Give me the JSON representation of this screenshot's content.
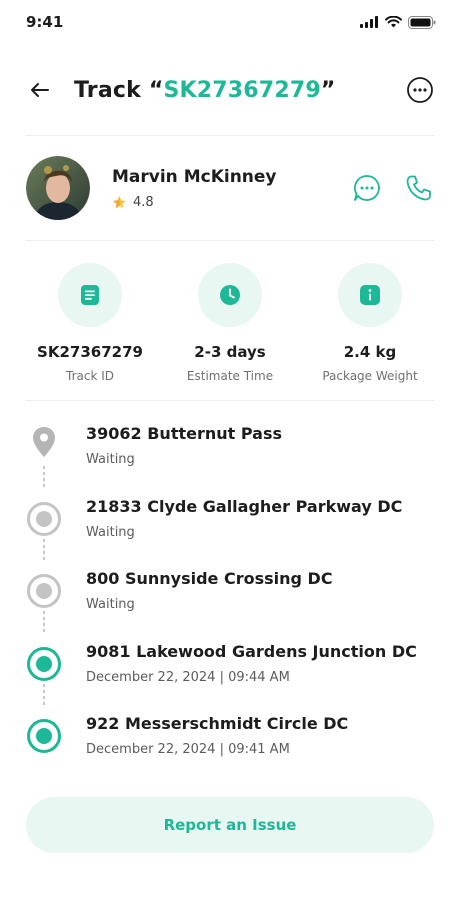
{
  "status_bar": {
    "time": "9:41"
  },
  "header": {
    "title_prefix": "Track “",
    "tracking_number": "SK27367279",
    "title_suffix": "”"
  },
  "courier": {
    "name": "Marvin McKinney",
    "rating": "4.8"
  },
  "stats": [
    {
      "value": "SK27367279",
      "label": "Track ID",
      "icon": "document-icon"
    },
    {
      "value": "2-3 days",
      "label": "Estimate Time",
      "icon": "clock-icon"
    },
    {
      "value": "2.4 kg",
      "label": "Package Weight",
      "icon": "info-icon"
    }
  ],
  "timeline": [
    {
      "title": "39062 Butternut Pass",
      "subtitle": "Waiting",
      "state": "destination"
    },
    {
      "title": "21833 Clyde Gallagher Parkway DC",
      "subtitle": "Waiting",
      "state": "pending"
    },
    {
      "title": "800 Sunnyside Crossing DC",
      "subtitle": "Waiting",
      "state": "pending"
    },
    {
      "title": "9081 Lakewood Gardens Junction DC",
      "subtitle": "December 22, 2024 | 09:44 AM",
      "state": "done"
    },
    {
      "title": "922 Messerschmidt Circle DC",
      "subtitle": "December 22, 2024 | 09:41 AM",
      "state": "done"
    }
  ],
  "report_button": {
    "label": "Report an Issue"
  },
  "colors": {
    "accent": "#1cb897",
    "accent_light": "#e8f7f2",
    "pending": "#c4c4c4"
  }
}
